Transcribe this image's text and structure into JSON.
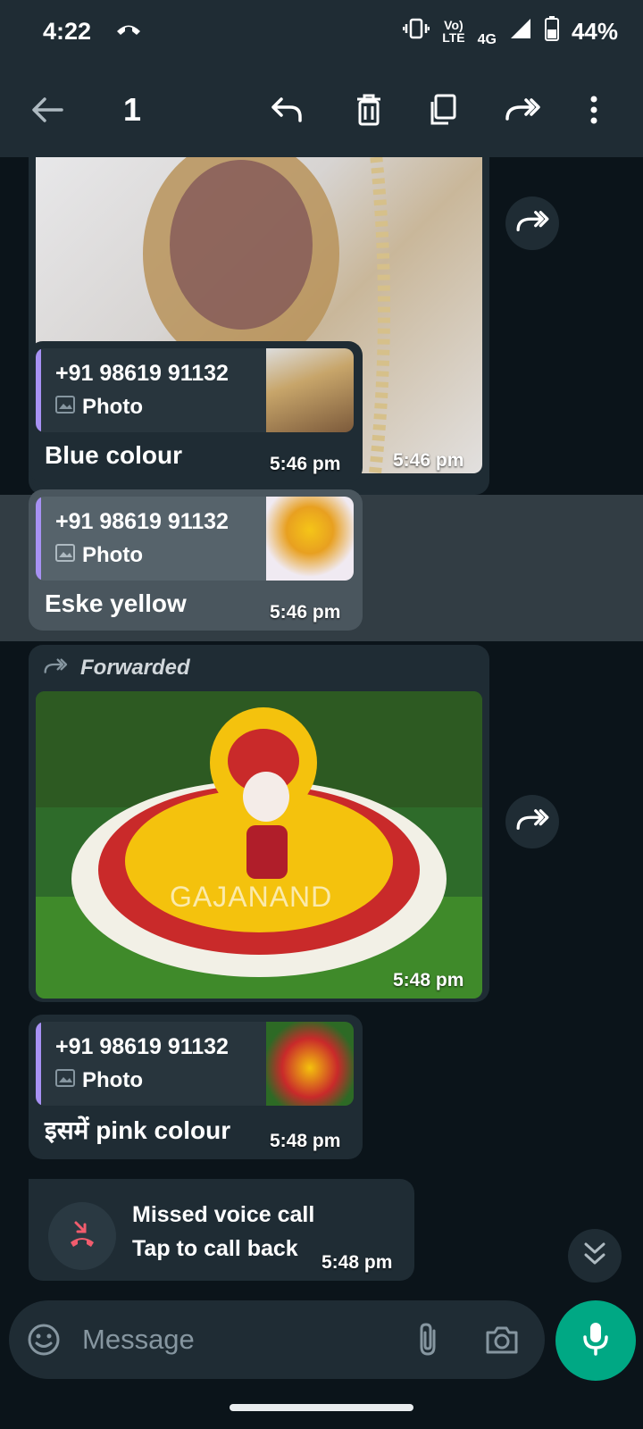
{
  "status_bar": {
    "time": "4:22",
    "network_top": "Vo)",
    "network_bottom": "LTE",
    "network_type": "4G",
    "battery": "44%"
  },
  "action_bar": {
    "selected_count": "1"
  },
  "messages": [
    {
      "kind": "image",
      "timestamp": "5:46 pm"
    },
    {
      "kind": "reply",
      "quoted_sender": "+91 98619 91132",
      "quoted_type": "Photo",
      "caption": "Blue colour",
      "timestamp": "5:46 pm"
    },
    {
      "kind": "reply",
      "quoted_sender": "+91 98619 91132",
      "quoted_type": "Photo",
      "caption": "Eske yellow",
      "timestamp": "5:46 pm",
      "selected": true
    },
    {
      "kind": "image",
      "forwarded_label": "Forwarded",
      "watermark": "GAJANAND",
      "timestamp": "5:48 pm"
    },
    {
      "kind": "reply",
      "quoted_sender": "+91 98619 91132",
      "quoted_type": "Photo",
      "caption": "इसमें pink colour",
      "timestamp": "5:48 pm"
    },
    {
      "kind": "call",
      "title": "Missed voice call",
      "subtitle": "Tap to call back",
      "timestamp": "5:48 pm"
    }
  ],
  "composer": {
    "placeholder": "Message"
  },
  "colors": {
    "accent": "#00a884",
    "bubble": "#1f2c34",
    "background": "#0b141a",
    "quote_bar": "#a791f3",
    "missed_call": "#f15c6d"
  }
}
